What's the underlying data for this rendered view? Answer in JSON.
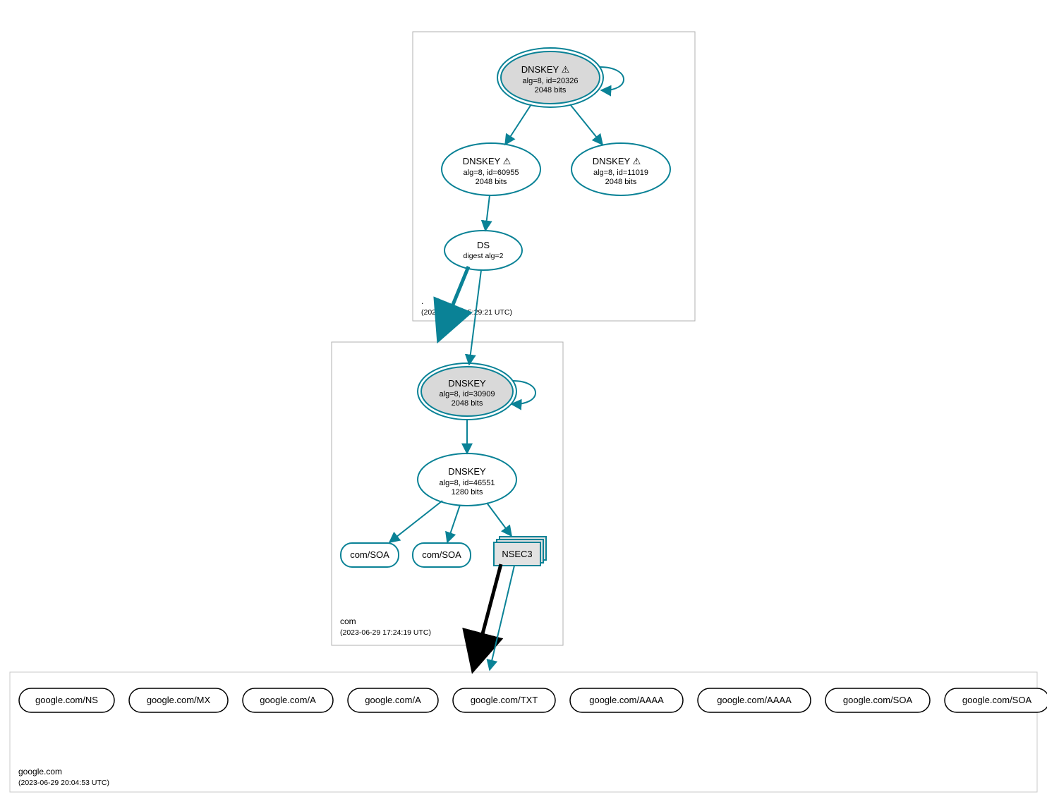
{
  "colors": {
    "teal": "#0a8296",
    "black": "#000000",
    "zoneBorder": "#b0b0b0",
    "ksk_fill": "#d9d9d9",
    "nsec_fill": "#e2e2e2"
  },
  "zones": {
    "root": {
      "name": ".",
      "timestamp": "(2023-06-29 15:29:21 UTC)",
      "ksk": {
        "label": "DNSKEY",
        "warn": "⚠",
        "sub1": "alg=8, id=20326",
        "sub2": "2048 bits"
      },
      "zsk1": {
        "label": "DNSKEY",
        "warn": "⚠",
        "sub1": "alg=8, id=60955",
        "sub2": "2048 bits"
      },
      "zsk2": {
        "label": "DNSKEY",
        "warn": "⚠",
        "sub1": "alg=8, id=11019",
        "sub2": "2048 bits"
      },
      "ds": {
        "label": "DS",
        "sub1": "digest alg=2"
      }
    },
    "com": {
      "name": "com",
      "timestamp": "(2023-06-29 17:24:19 UTC)",
      "ksk": {
        "label": "DNSKEY",
        "sub1": "alg=8, id=30909",
        "sub2": "2048 bits"
      },
      "zsk": {
        "label": "DNSKEY",
        "sub1": "alg=8, id=46551",
        "sub2": "1280 bits"
      },
      "soa1": {
        "label": "com/SOA"
      },
      "soa2": {
        "label": "com/SOA"
      },
      "nsec": {
        "label": "NSEC3"
      }
    },
    "google": {
      "name": "google.com",
      "timestamp": "(2023-06-29 20:04:53 UTC)",
      "rrsets": [
        "google.com/NS",
        "google.com/MX",
        "google.com/A",
        "google.com/A",
        "google.com/TXT",
        "google.com/AAAA",
        "google.com/AAAA",
        "google.com/SOA",
        "google.com/SOA"
      ]
    }
  }
}
